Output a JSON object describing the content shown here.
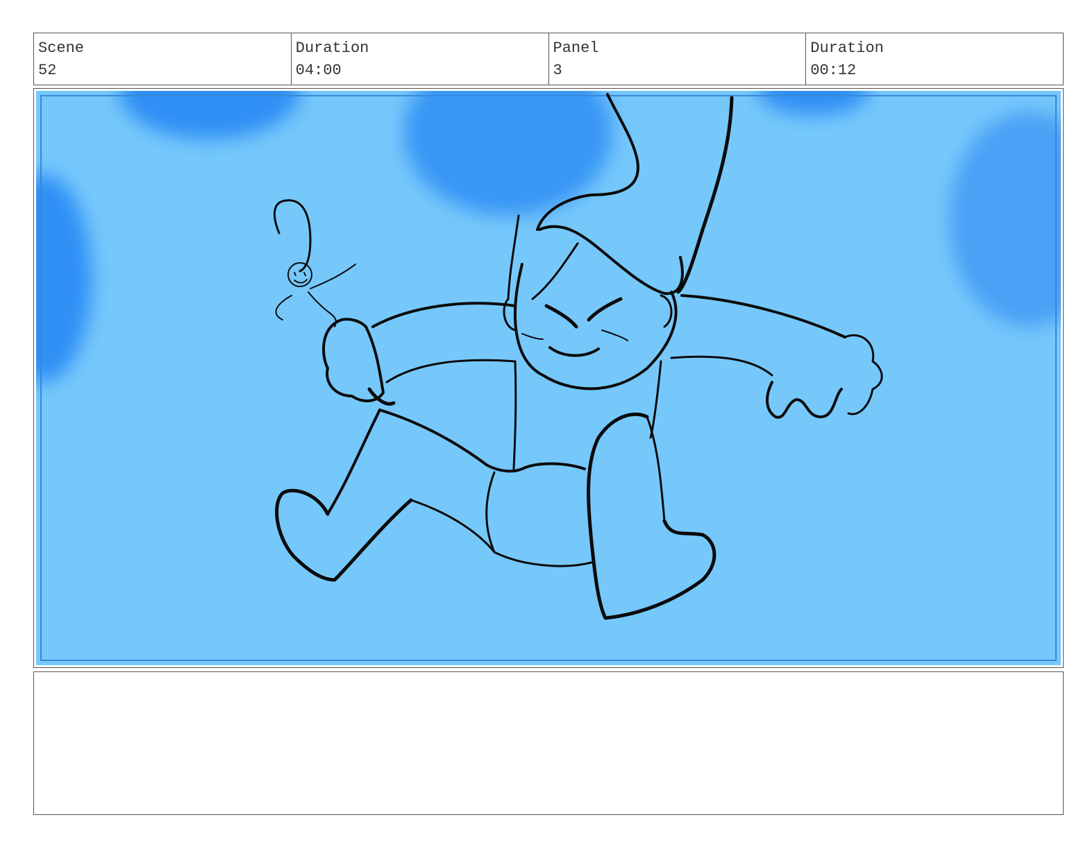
{
  "header": {
    "scene": {
      "label": "Scene",
      "value": "52"
    },
    "scene_duration": {
      "label": "Duration",
      "value": "04:00"
    },
    "panel": {
      "label": "Panel",
      "value": "3"
    },
    "panel_duration": {
      "label": "Duration",
      "value": "00:12"
    }
  },
  "colors": {
    "sky": "#76c8fb",
    "blob": "#2f8ff5",
    "line": "#0b0b0b"
  },
  "notes": {
    "text": ""
  }
}
